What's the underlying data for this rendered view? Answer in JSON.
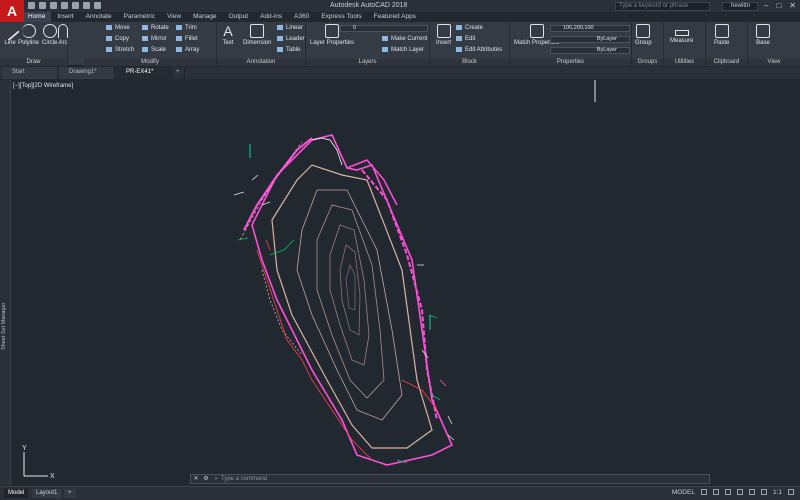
{
  "app": {
    "title": "Autodesk AutoCAD 2018",
    "logo": "A",
    "search_placeholder": "Type a keyword or phrase",
    "user": "hewittn"
  },
  "ribbon_tabs": [
    "Home",
    "Insert",
    "Annotate",
    "Parametric",
    "View",
    "Manage",
    "Output",
    "Add-ins",
    "A360",
    "Express Tools",
    "Featured Apps"
  ],
  "panels": {
    "draw": {
      "title": "Draw",
      "tools": [
        "Line",
        "Polyline",
        "Circle",
        "Arc"
      ]
    },
    "modify": {
      "title": "Modify",
      "tools": [
        "Move",
        "Rotate",
        "Trim",
        "Copy",
        "Mirror",
        "Fillet",
        "Stretch",
        "Scale",
        "Array"
      ]
    },
    "annotation": {
      "title": "Annotation",
      "tools": [
        "Text",
        "Dimension",
        "Linear",
        "Leader",
        "Table"
      ]
    },
    "layers": {
      "title": "Layers",
      "tools": [
        "Layer Properties",
        "Make Current",
        "Match Layer"
      ],
      "current": "0"
    },
    "block": {
      "title": "Block",
      "tools": [
        "Insert",
        "Create",
        "Edit",
        "Edit Attributes"
      ]
    },
    "properties": {
      "title": "Properties",
      "tools": [
        "Match Properties"
      ],
      "color": "100,200,100",
      "linetype": "ByLayer",
      "lineweight": "ByLayer"
    },
    "groups": {
      "title": "Groups",
      "tools": [
        "Group"
      ]
    },
    "utilities": {
      "title": "Utilities",
      "tools": [
        "Measure"
      ]
    },
    "clipboard": {
      "title": "Clipboard",
      "tools": [
        "Paste"
      ]
    },
    "view": {
      "title": "View",
      "tools": [
        "Base"
      ]
    }
  },
  "file_tabs": [
    "Start",
    "Drawing1*",
    "PR-EX41*"
  ],
  "viewport_label": "[−][Top][2D Wireframe]",
  "sheet_manager": "Sheet Set Manager",
  "command_placeholder": "Type a command",
  "layout_tabs": [
    "Model",
    "Layout1"
  ],
  "status": {
    "model": "MODEL",
    "scale": "1:1"
  },
  "axis": {
    "y": "Y",
    "x": "X"
  }
}
